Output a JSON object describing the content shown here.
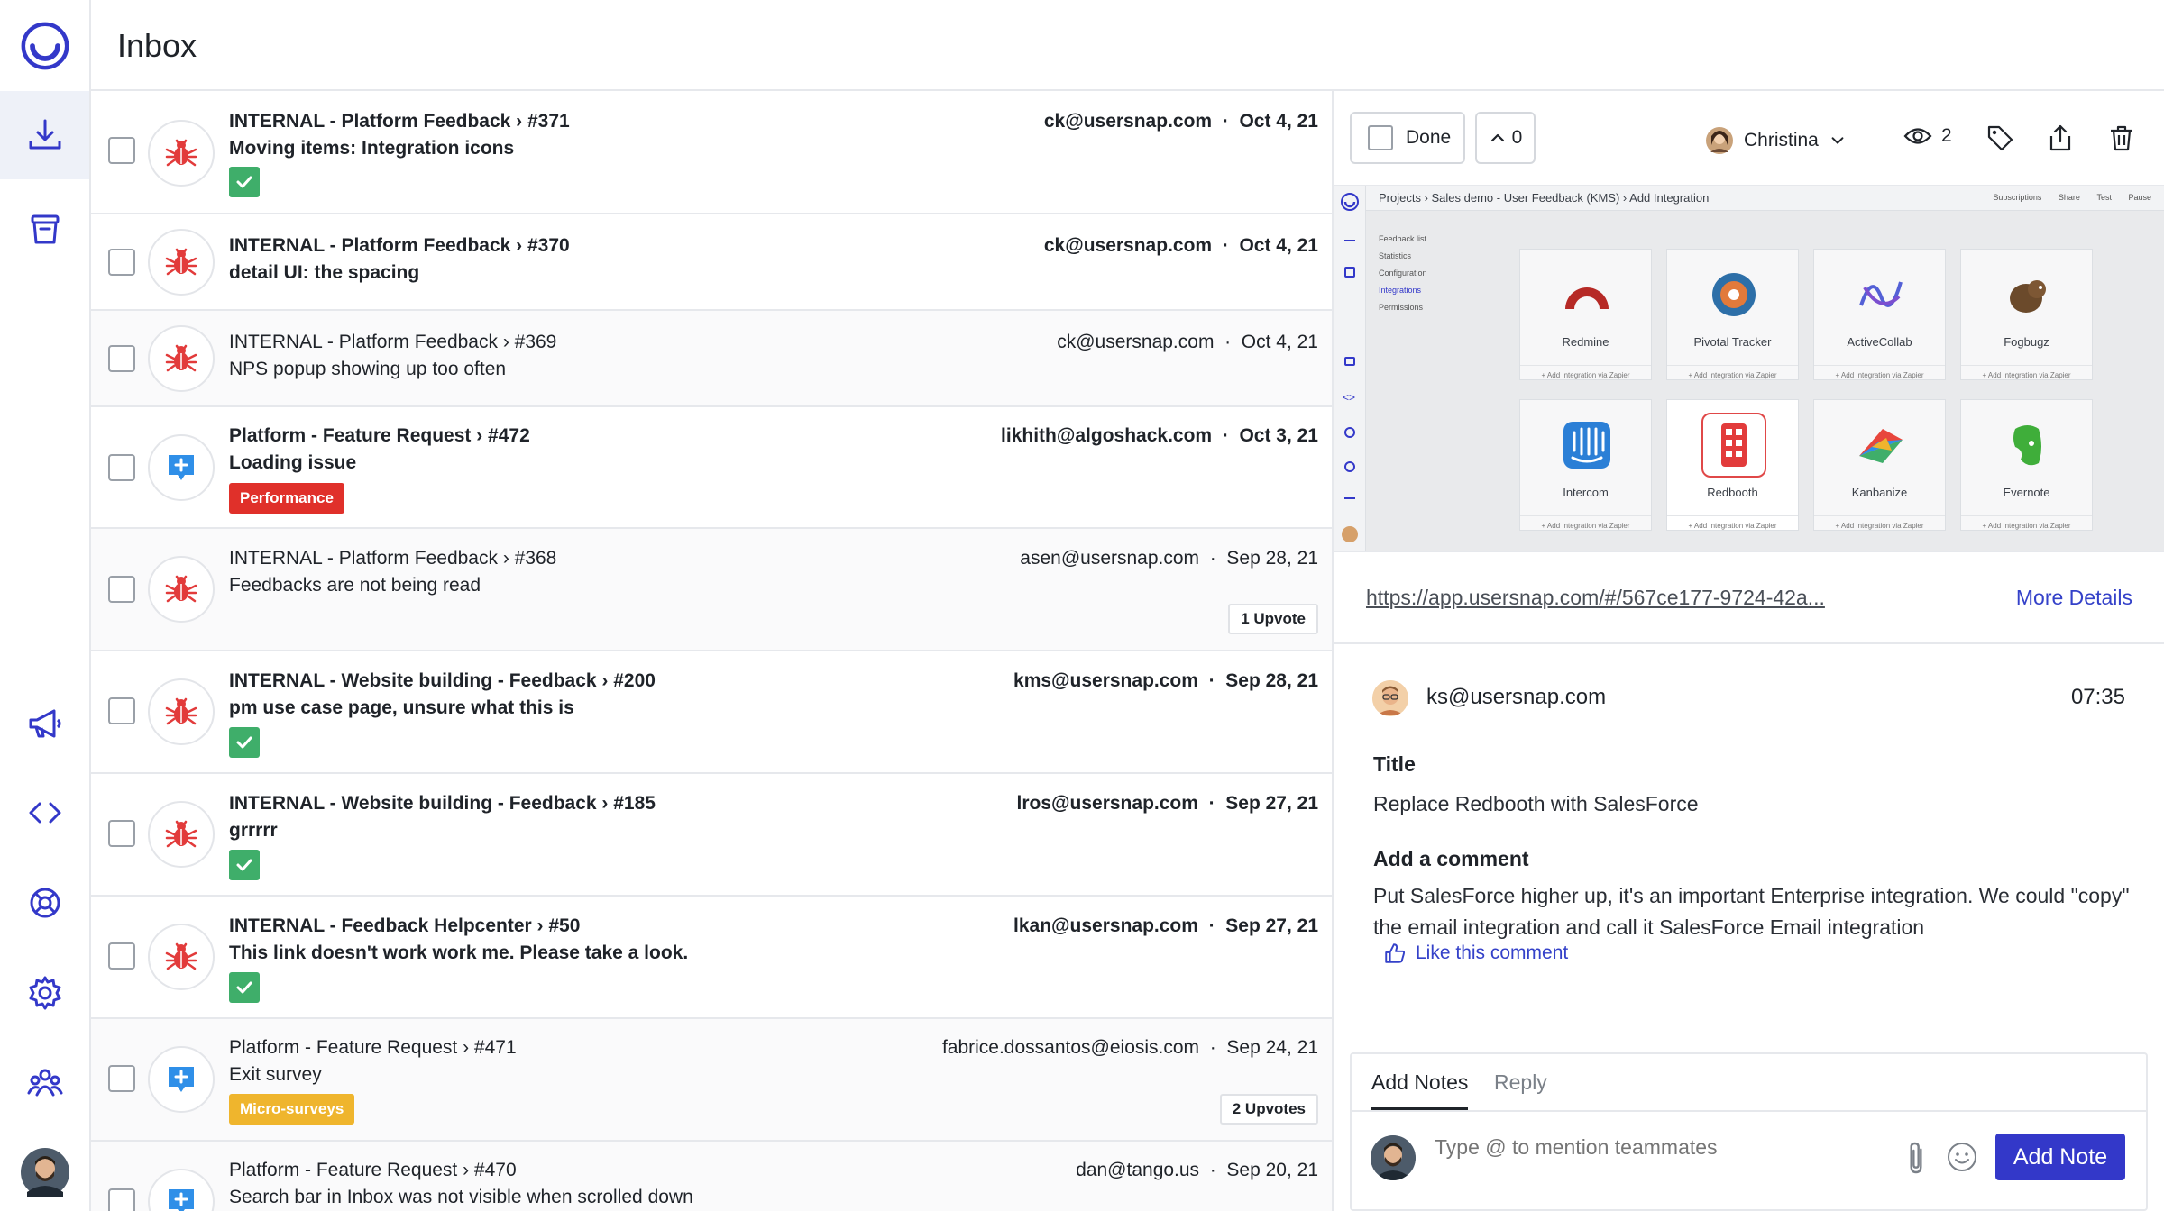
{
  "app": {
    "page_title": "Inbox",
    "accent": "#3338c9"
  },
  "sidebar": {
    "items": [
      {
        "name": "logo",
        "icon": "usersnap-logo-icon"
      },
      {
        "name": "inbox",
        "icon": "inbox-download-icon",
        "active": true
      },
      {
        "name": "archive",
        "icon": "archive-box-icon"
      },
      {
        "name": "announcements",
        "icon": "megaphone-icon"
      },
      {
        "name": "code",
        "icon": "code-brackets-icon"
      },
      {
        "name": "help",
        "icon": "lifebuoy-icon"
      },
      {
        "name": "settings",
        "icon": "gear-icon"
      },
      {
        "name": "team",
        "icon": "team-icon"
      },
      {
        "name": "profile",
        "icon": "user-avatar-icon"
      }
    ]
  },
  "inbox": {
    "items": [
      {
        "type": "bug",
        "project": "INTERNAL - Platform Feedback › #371",
        "title": "Moving items: Integration icons",
        "email": "ck@usersnap.com",
        "date": "Oct 4, 21",
        "unread": true,
        "done": true
      },
      {
        "type": "bug",
        "project": "INTERNAL - Platform Feedback › #370",
        "title": "detail UI: the spacing",
        "email": "ck@usersnap.com",
        "date": "Oct 4, 21",
        "unread": true
      },
      {
        "type": "bug",
        "project": "INTERNAL - Platform Feedback › #369",
        "title": "NPS popup showing up too often",
        "email": "ck@usersnap.com",
        "date": "Oct 4, 21",
        "unread": false
      },
      {
        "type": "feature",
        "project": "Platform - Feature Request › #472",
        "title": "Loading issue",
        "email": "likhith@algoshack.com",
        "date": "Oct 3, 21",
        "unread": true,
        "tag": "Performance",
        "tag_color": "#e0302a"
      },
      {
        "type": "bug",
        "project": "INTERNAL - Platform Feedback › #368",
        "title": "Feedbacks are not being read",
        "email": "asen@usersnap.com",
        "date": "Sep 28, 21",
        "unread": false,
        "upvotes": "1 Upvote"
      },
      {
        "type": "bug",
        "project": "INTERNAL - Website building - Feedback › #200",
        "title": "pm use case page, unsure what this is",
        "email": "kms@usersnap.com",
        "date": "Sep 28, 21",
        "unread": true,
        "done": true
      },
      {
        "type": "bug",
        "project": "INTERNAL - Website building - Feedback › #185",
        "title": "grrrrr",
        "email": "lros@usersnap.com",
        "date": "Sep 27, 21",
        "unread": true,
        "done": true
      },
      {
        "type": "bug",
        "project": "INTERNAL - Feedback Helpcenter › #50",
        "title": "This link doesn't work work me. Please take a look.",
        "email": "lkan@usersnap.com",
        "date": "Sep 27, 21",
        "unread": true,
        "done": true
      },
      {
        "type": "feature",
        "project": "Platform - Feature Request › #471",
        "title": "Exit survey",
        "email": "fabrice.dossantos@eiosis.com",
        "date": "Sep 24, 21",
        "unread": false,
        "tag": "Micro-surveys",
        "tag_color": "#efb52d",
        "upvotes": "2 Upvotes"
      },
      {
        "type": "feature",
        "project": "Platform - Feature Request › #470",
        "title": "Search bar in Inbox was not visible when scrolled down",
        "email": "dan@tango.us",
        "date": "Sep 20, 21",
        "unread": false
      }
    ],
    "separator": "·"
  },
  "detail": {
    "toolbar": {
      "done_label": "Done",
      "upvote_count": "0",
      "assignee": "Christina",
      "viewers_count": "2"
    },
    "screenshot": {
      "breadcrumb": "Projects  ›  Sales demo - User Feedback (KMS)  ›  Add Integration",
      "tools": [
        "Subscriptions",
        "Share",
        "Test",
        "Pause"
      ],
      "nav": [
        "Feedback list",
        "Statistics",
        "Configuration",
        "Integrations",
        "Permissions"
      ],
      "cards": [
        {
          "name": "Redmine",
          "sub": "+ Add Integration via Zapier"
        },
        {
          "name": "Pivotal Tracker",
          "sub": "+ Add Integration via Zapier"
        },
        {
          "name": "ActiveCollab",
          "sub": "+ Add Integration via Zapier"
        },
        {
          "name": "Fogbugz",
          "sub": "+ Add Integration via Zapier"
        },
        {
          "name": "Intercom",
          "sub": "+ Add Integration via Zapier"
        },
        {
          "name": "Redbooth",
          "sub": "+ Add Integration via Zapier"
        },
        {
          "name": "Kanbanize",
          "sub": "+ Add Integration via Zapier"
        },
        {
          "name": "Evernote",
          "sub": "+ Add Integration via Zapier"
        }
      ]
    },
    "url": "https://app.usersnap.com/#/567ce177-9724-42a...",
    "more_details": "More Details",
    "comment": {
      "author": "ks@usersnap.com",
      "time": "07:35",
      "title_label": "Title",
      "title_value": "Replace Redbooth with SalesForce",
      "comment_label": "Add a comment",
      "comment_value": "Put SalesForce higher up, it's an important Enterprise integration. We could \"copy\" the email integration and call it SalesForce Email integration",
      "like_label": "Like this comment"
    },
    "notes": {
      "tabs": [
        "Add Notes",
        "Reply"
      ],
      "placeholder": "Type @ to mention teammates",
      "submit_label": "Add Note"
    }
  }
}
